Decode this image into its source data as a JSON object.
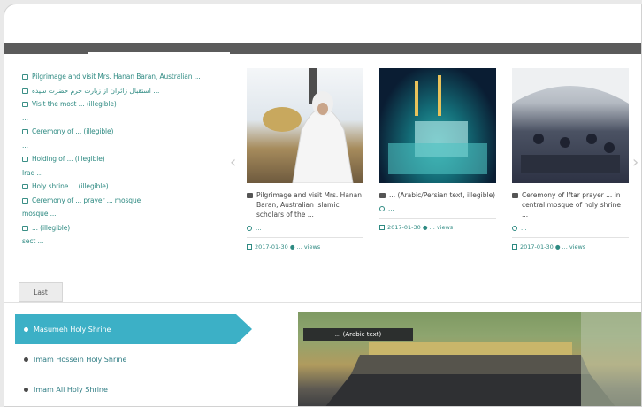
{
  "news_list": [
    {
      "text": "Pilgrimage and visit Mrs. Hanan Baran, Australian ..."
    },
    {
      "text": "استقبال زائران از زیارت حرم حضرت سیده ..."
    },
    {
      "text": "Visit the most ...  (illegible)"
    },
    {
      "text": "..."
    },
    {
      "text": "Ceremony of ... (illegible)"
    },
    {
      "text": "..."
    },
    {
      "text": "Holding of ... (illegible)"
    },
    {
      "text": "Iraq ..."
    },
    {
      "text": "Holy shrine ... (illegible)"
    },
    {
      "text": "Ceremony of ... prayer ... mosque"
    },
    {
      "text": "mosque ..."
    },
    {
      "text": "... (illegible)"
    },
    {
      "text": "sect ..."
    }
  ],
  "cards": [
    {
      "title": "Pilgrimage and visit Mrs. Hanan Baran, Australian Islamic scholars of the ...",
      "author": "...",
      "meta": "2017-01-30  ●  ... views"
    },
    {
      "title": "... (Arabic/Persian text, illegible)",
      "author": "...",
      "meta": "2017-01-30  ●  ... views"
    },
    {
      "title": "Ceremony of Iftar prayer ... in central mosque of holy shrine ...",
      "author": "...",
      "meta": "2017-01-30  ●  ... views"
    }
  ],
  "last_button": "Last",
  "shrine_nav": [
    {
      "label": "Masumeh Holy Shrine",
      "active": true
    },
    {
      "label": "Imam Hossein Holy Shrine",
      "active": false
    },
    {
      "label": "Imam Ali Holy Shrine",
      "active": false
    }
  ],
  "shrine_banner": "... (Arabic text)",
  "icons": {
    "list_item": "document-icon",
    "card_title": "image-icon",
    "author": "user-icon",
    "date": "calendar-icon",
    "arrow_left": "chevron-left-icon",
    "arrow_right": "chevron-right-icon"
  },
  "colors": {
    "accent": "#3cb0c6",
    "link": "#2e8a82",
    "topbar": "#5b5b5b"
  }
}
